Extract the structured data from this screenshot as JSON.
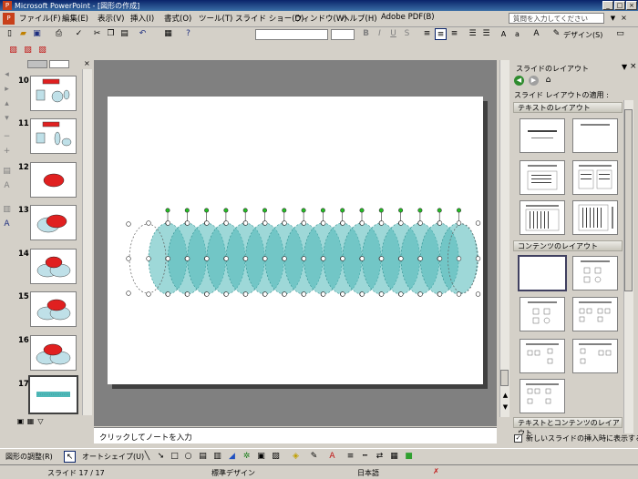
{
  "window": {
    "title": "Microsoft PowerPoint - [図形の作成]"
  },
  "menu": {
    "items": [
      "ファイル(F)",
      "編集(E)",
      "表示(V)",
      "挿入(I)",
      "書式(O)",
      "ツール(T)",
      "スライド ショー(D)",
      "ウィンドウ(W)",
      "ヘルプ(H)",
      "Adobe PDF(B)"
    ],
    "help_placeholder": "質問を入力してください"
  },
  "toolbar": {
    "design_label": "デザイン(S)"
  },
  "slides_pane": {
    "numbers": [
      "10",
      "11",
      "12",
      "13",
      "14",
      "15",
      "16",
      "17"
    ],
    "selected": "17"
  },
  "notes": {
    "placeholder": "クリックしてノートを入力"
  },
  "task_pane": {
    "title": "スライドのレイアウト",
    "apply_label": "スライド レイアウトの適用 :",
    "sections": [
      "テキストのレイアウト",
      "コンテンツのレイアウト",
      "テキストとコンテンツのレイアウト"
    ],
    "show_on_insert": "新しいスライドの挿入時に表示する"
  },
  "drawing_toolbar": {
    "draw_menu": "図形の調整(R)",
    "autoshape_menu": "オートシェイプ(U)"
  },
  "status": {
    "slide": "スライド 17 / 17",
    "design": "標準デザイン",
    "language": "日本語"
  },
  "colors": {
    "shape_fill": "#4fb8b8",
    "accent_red": "#e02020",
    "handle_green": "#22c022"
  }
}
